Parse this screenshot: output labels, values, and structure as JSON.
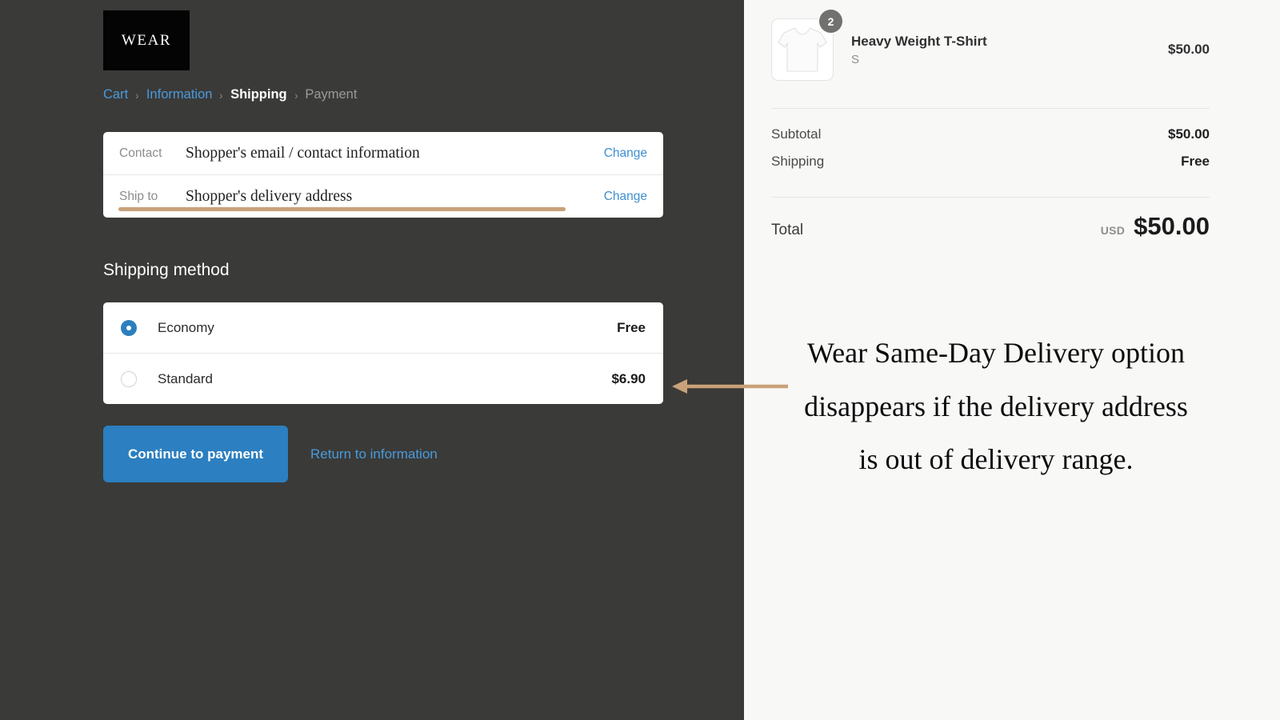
{
  "brand": {
    "logo_text": "WEAR"
  },
  "breadcrumb": {
    "items": [
      {
        "label": "Cart",
        "state": "link"
      },
      {
        "label": "Information",
        "state": "link"
      },
      {
        "label": "Shipping",
        "state": "current"
      },
      {
        "label": "Payment",
        "state": "future"
      }
    ],
    "separator": "›"
  },
  "contact_card": {
    "rows": [
      {
        "label": "Contact",
        "value": "Shopper's email / contact information",
        "action": "Change"
      },
      {
        "label": "Ship to",
        "value": "Shopper's delivery address",
        "action": "Change"
      }
    ]
  },
  "shipping_method": {
    "title": "Shipping method",
    "options": [
      {
        "name": "Economy",
        "price": "Free",
        "selected": true
      },
      {
        "name": "Standard",
        "price": "$6.90",
        "selected": false
      }
    ]
  },
  "actions": {
    "primary_label": "Continue to payment",
    "secondary_label": "Return to information"
  },
  "order_summary": {
    "line_items": [
      {
        "title": "Heavy Weight T-Shirt",
        "variant": "S",
        "quantity": "2",
        "price": "$50.00",
        "image": "white-tshirt-thumbnail"
      }
    ],
    "totals": [
      {
        "label": "Subtotal",
        "value": "$50.00"
      },
      {
        "label": "Shipping",
        "value": "Free"
      }
    ],
    "grand_total": {
      "label": "Total",
      "currency": "USD",
      "amount": "$50.00"
    }
  },
  "annotation": {
    "text": "Wear Same-Day Delivery option disappears if the delivery address is out of delivery range.",
    "arrow": "left-arrow",
    "color": "#c9a179"
  },
  "colors": {
    "dark_pane": "#3a3a38",
    "light_pane": "#f8f8f7",
    "accent_blue": "#2c7fc0",
    "link_blue": "#4a9bdc",
    "annotation_tan": "#c9a179"
  }
}
